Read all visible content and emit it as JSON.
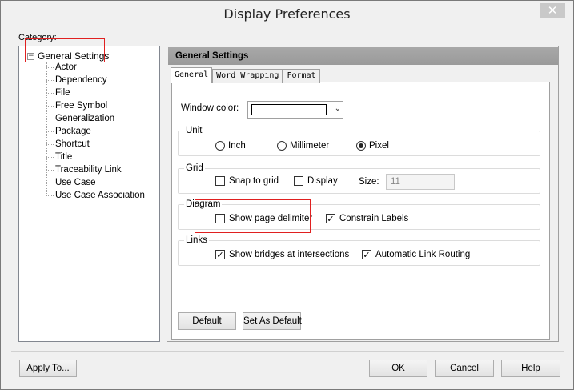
{
  "window": {
    "title": "Display Preferences",
    "close_glyph": "✕"
  },
  "category": {
    "label": "Category:",
    "root": "General Settings",
    "children": [
      "Actor",
      "Dependency",
      "File",
      "Free Symbol",
      "Generalization",
      "Package",
      "Shortcut",
      "Title",
      "Traceability Link",
      "Use Case",
      "Use Case Association"
    ]
  },
  "panel": {
    "header": "General Settings",
    "tabs": [
      "General",
      "Word Wrapping",
      "Format"
    ],
    "window_color_label": "Window color:",
    "window_color_value": "#ffffff",
    "unit": {
      "title": "Unit",
      "options": [
        "Inch",
        "Millimeter",
        "Pixel"
      ],
      "selected": "Pixel"
    },
    "grid": {
      "title": "Grid",
      "snap_label": "Snap to grid",
      "snap_checked": false,
      "display_label": "Display",
      "display_checked": false,
      "size_label": "Size:",
      "size_value": "11"
    },
    "diagram": {
      "title": "Diagram",
      "page_delimiter_label": "Show page delimiter",
      "page_delimiter_checked": false,
      "constrain_label": "Constrain Labels",
      "constrain_checked": true
    },
    "links": {
      "title": "Links",
      "bridges_label": "Show bridges at intersections",
      "bridges_checked": true,
      "routing_label": "Automatic Link Routing",
      "routing_checked": true
    },
    "default_button": "Default",
    "set_default_button": "Set As Default"
  },
  "footer": {
    "apply": "Apply To...",
    "ok": "OK",
    "cancel": "Cancel",
    "help": "Help"
  },
  "colors": {
    "highlight": "#e02020",
    "header_bg": "#a0a0a0"
  }
}
